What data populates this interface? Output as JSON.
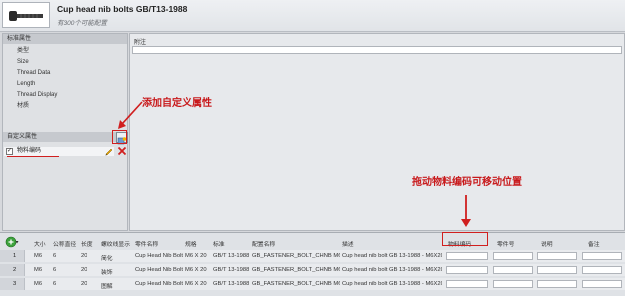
{
  "header": {
    "title": "Cup head nib bolts GB/T13-1988",
    "subtitle": "有300个可能配置"
  },
  "left_panel": {
    "standard_props_title": "标准属性",
    "standard_props": [
      "类型",
      "Size",
      "Thread Data",
      "Length",
      "Thread Display",
      "材质"
    ],
    "custom_props_title": "自定义属性",
    "custom_prop_item": "物料编码",
    "custom_prop_checked": true
  },
  "right_panel": {
    "note_label": "附注"
  },
  "annotations": {
    "add_custom_attr": "添加自定义属性",
    "drag_code_move": "拖动物料编码可移动位置"
  },
  "table": {
    "headers": [
      "大小",
      "公称直径",
      "长度",
      "螺纹线显示",
      "零件名称",
      "规格",
      "标准",
      "配置名称",
      "描述",
      "物料编码",
      "零件号",
      "说明",
      "备注"
    ],
    "rows": [
      {
        "num": "1",
        "size": "M6",
        "diameter": "6",
        "length": "20",
        "thread_display": "简化",
        "part_name": "Cup Head Nib Bolt",
        "spec": "M6 X 20",
        "standard": "GB/T 13-1988",
        "config": "GB_FASTENER_BOLT_CHNB M6X20-N",
        "desc": "Cup head nib bolt GB 13-1988 - M6X20-N"
      },
      {
        "num": "2",
        "size": "M6",
        "diameter": "6",
        "length": "20",
        "thread_display": "装饰",
        "part_name": "Cup Head Nib Bolt",
        "spec": "M6 X 20",
        "standard": "GB/T 13-1988",
        "config": "GB_FASTENER_BOLT_CHNB M6X20-C",
        "desc": "Cup head nib bolt GB 13-1988 - M6X20-C"
      },
      {
        "num": "3",
        "size": "M6",
        "diameter": "6",
        "length": "20",
        "thread_display": "图解",
        "part_name": "Cup Head Nib Bolt",
        "spec": "M6 X 20",
        "standard": "GB/T 13-1988",
        "config": "GB_FASTENER_BOLT_CHNB M6X20-S",
        "desc": "Cup head nib bolt GB 13-1988 - M6X20-S"
      }
    ]
  },
  "colors": {
    "annotation_red": "#c8191b",
    "accent_green": "#2f8b2f"
  }
}
